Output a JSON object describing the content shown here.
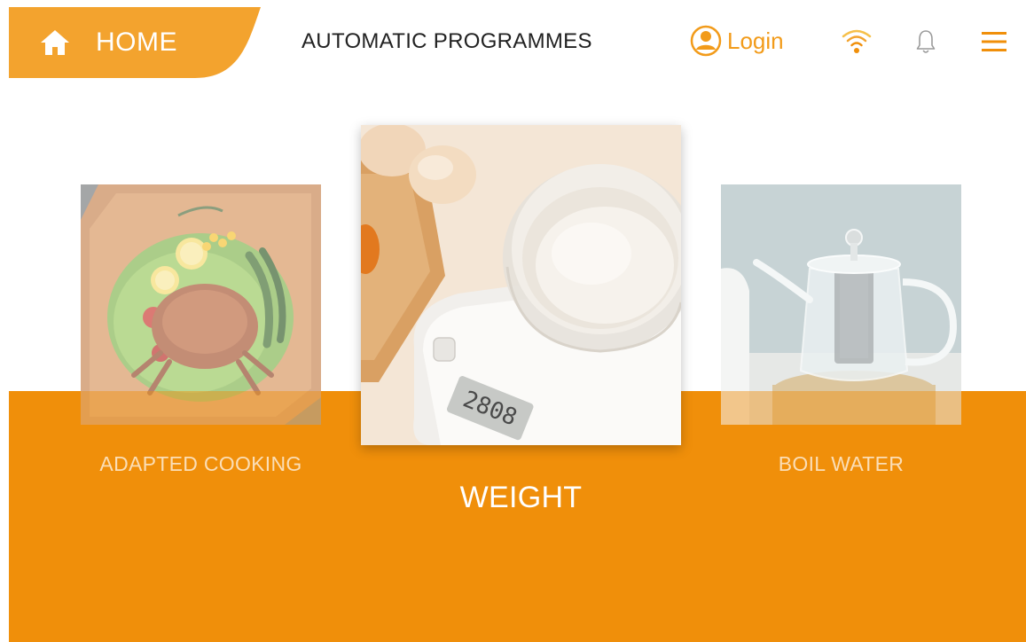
{
  "header": {
    "home_label": "HOME",
    "title": "AUTOMATIC PROGRAMMES",
    "login_label": "Login",
    "icons": [
      "home-icon",
      "user-circle-icon",
      "wifi-icon",
      "bell-icon",
      "menu-icon"
    ]
  },
  "colors": {
    "accent": "#f08f0a",
    "home_tab": "#f3a32e",
    "login_text": "#f29b1a",
    "background": "#ffffff"
  },
  "programmes": [
    {
      "label": "ADAPTED COOKING",
      "image": "crab-dish-photo",
      "selected": false
    },
    {
      "label": "WEIGHT",
      "image": "kitchen-scale-photo",
      "selected": true
    },
    {
      "label": "BOIL WATER",
      "image": "glass-teapot-photo",
      "selected": false
    }
  ]
}
